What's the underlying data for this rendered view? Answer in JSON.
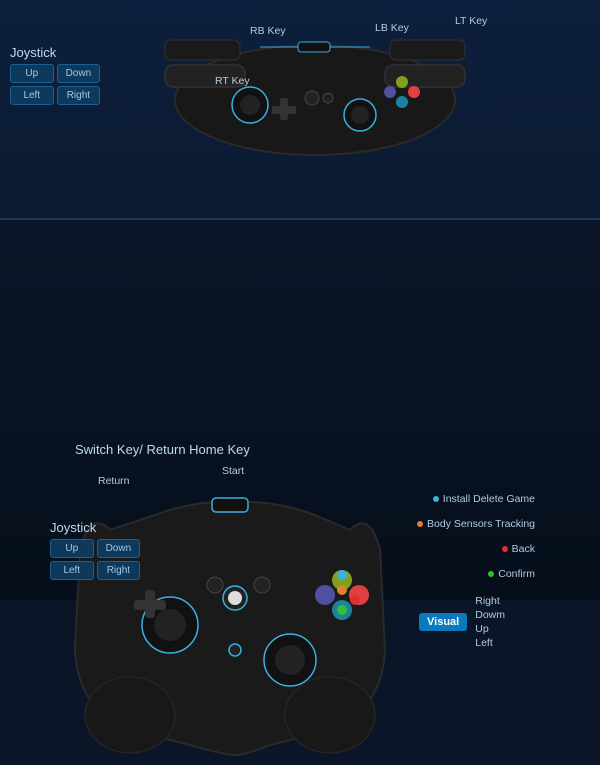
{
  "top": {
    "joystick_title": "Joystick",
    "keys": {
      "up": "Up",
      "down": "Down",
      "left": "Left",
      "right": "Right"
    },
    "labels": {
      "rb": "RB Key",
      "lb": "LB Key",
      "lt": "LT Key",
      "rt": "RT Key"
    }
  },
  "bottom": {
    "switch_key": "Switch Key/ Return Home Key",
    "start": "Start",
    "return": "Return",
    "annotations": {
      "install": "Install Delete Game",
      "body": "Body Sensors Tracking",
      "back": "Back",
      "confirm": "Confirm"
    },
    "visual": "Visual",
    "visual_dirs": {
      "right": "Right",
      "down": "Dowm",
      "up": "Up",
      "left": "Left"
    },
    "joystick_title": "Joystick",
    "keys": {
      "up": "Up",
      "down": "Down",
      "left": "Left",
      "right": "Right"
    }
  },
  "colors": {
    "accent": "#3ab0e0",
    "bg_top": "#0d1f3c",
    "bg_bottom": "#0a1628",
    "key_bg": "#0d3a5c",
    "key_border": "#1a6090",
    "text": "#b0cce0",
    "visual_badge": "#0a7abf"
  }
}
